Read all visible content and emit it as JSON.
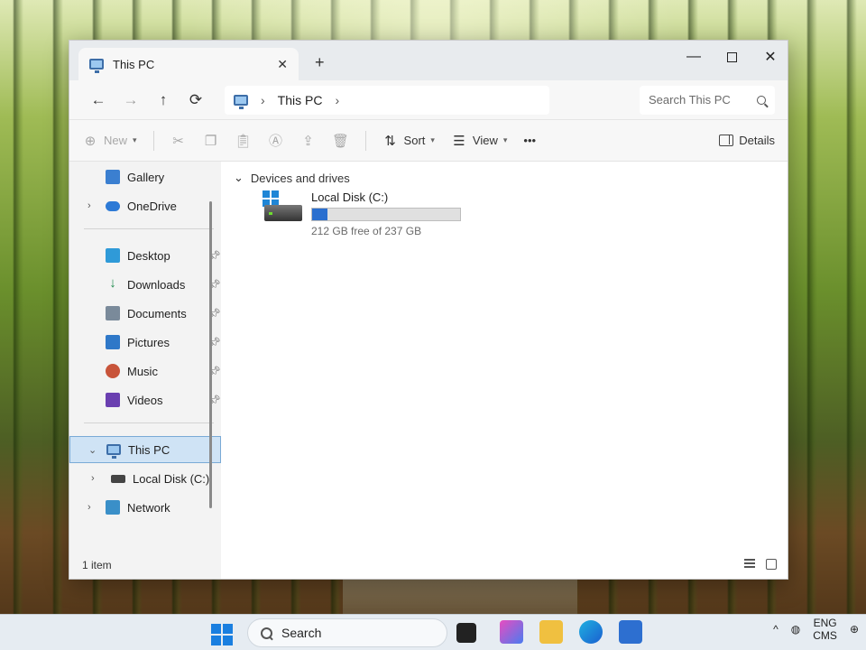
{
  "window": {
    "tab_title": "This PC",
    "tab_close": "✕",
    "new_tab": "+",
    "minimize": "—",
    "close": "✕"
  },
  "nav": {
    "back": "←",
    "forward": "→",
    "up": "↑",
    "refresh": "⟳",
    "breadcrumb": "This PC",
    "chevron": "›",
    "search_placeholder": "Search This PC"
  },
  "toolbar": {
    "new_label": "New",
    "sort_label": "Sort",
    "view_label": "View",
    "more_label": "•••",
    "details_label": "Details"
  },
  "sidebar": {
    "items": [
      {
        "label": "Gallery"
      },
      {
        "label": "OneDrive"
      },
      {
        "label": "Desktop"
      },
      {
        "label": "Downloads"
      },
      {
        "label": "Documents"
      },
      {
        "label": "Pictures"
      },
      {
        "label": "Music"
      },
      {
        "label": "Videos"
      },
      {
        "label": "This PC"
      },
      {
        "label": "Local Disk (C:)"
      },
      {
        "label": "Network"
      }
    ]
  },
  "content": {
    "group_header": "Devices and drives",
    "drive_name": "Local Disk (C:)",
    "drive_free": "212 GB free of 237 GB",
    "drive_used_fraction": 0.105
  },
  "status": {
    "item_count": "1 item"
  },
  "taskbar": {
    "search_label": "Search",
    "lang_top": "ENG",
    "lang_bottom": "CMS",
    "tray_chevron": "^",
    "accent": "#1a7fe0"
  }
}
